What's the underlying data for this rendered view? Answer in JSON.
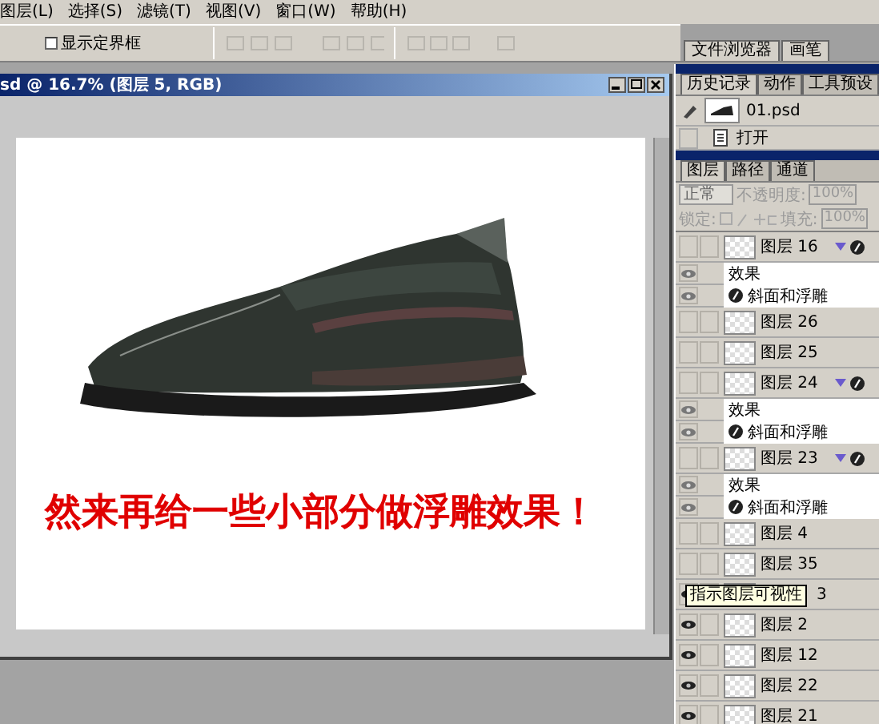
{
  "menu": [
    "图层(L)",
    "选择(S)",
    "滤镜(T)",
    "视图(V)",
    "窗口(W)",
    "帮助(H)"
  ],
  "options_bar": {
    "show_bounds": {
      "label": "显示定界框",
      "checked": false
    }
  },
  "palette_well": [
    {
      "label": "文件浏览器",
      "selected": false
    },
    {
      "label": "画笔",
      "selected": false
    }
  ],
  "document": {
    "title": "sd @ 16.7% (图层 5, RGB)",
    "caption": "然来再给一些小部分做浮雕效果！"
  },
  "history_panel": {
    "tabs": [
      {
        "label": "历史记录",
        "selected": true
      },
      {
        "label": "动作",
        "selected": false
      },
      {
        "label": "工具预设",
        "selected": false
      }
    ],
    "snapshot": "01.psd",
    "steps": [
      "打开"
    ]
  },
  "layers_panel": {
    "tabs": [
      {
        "label": "图层",
        "selected": true
      },
      {
        "label": "路径",
        "selected": false
      },
      {
        "label": "通道",
        "selected": false
      }
    ],
    "blend_mode": "正常",
    "opacity_label": "不透明度:",
    "opacity": "100%",
    "lock_label": "锁定:",
    "fill_label": "填充:",
    "fill": "100%",
    "layers": [
      {
        "name": "图层 16",
        "visible": false,
        "expanded": true,
        "effects": [
          {
            "kind": "header",
            "name": "效果",
            "visible": true
          },
          {
            "kind": "effect",
            "name": "斜面和浮雕",
            "visible": true
          }
        ]
      },
      {
        "name": "图层 26",
        "visible": false
      },
      {
        "name": "图层 25",
        "visible": false
      },
      {
        "name": "图层 24",
        "visible": false,
        "expanded": true,
        "effects": [
          {
            "kind": "header",
            "name": "效果",
            "visible": true
          },
          {
            "kind": "effect",
            "name": "斜面和浮雕",
            "visible": true
          }
        ]
      },
      {
        "name": "图层 23",
        "visible": false,
        "expanded": true,
        "effects": [
          {
            "kind": "header",
            "name": "效果",
            "visible": true
          },
          {
            "kind": "effect",
            "name": "斜面和浮雕",
            "visible": true
          }
        ]
      },
      {
        "name": "图层 4",
        "visible": false
      },
      {
        "name": "图层 35",
        "visible": false
      },
      {
        "name": "3",
        "visible": true,
        "tooltip": "指示图层可视性"
      },
      {
        "name": "图层 2",
        "visible": true
      },
      {
        "name": "图层 12",
        "visible": true
      },
      {
        "name": "图层 22",
        "visible": true
      },
      {
        "name": "图层 21",
        "visible": true
      }
    ]
  }
}
